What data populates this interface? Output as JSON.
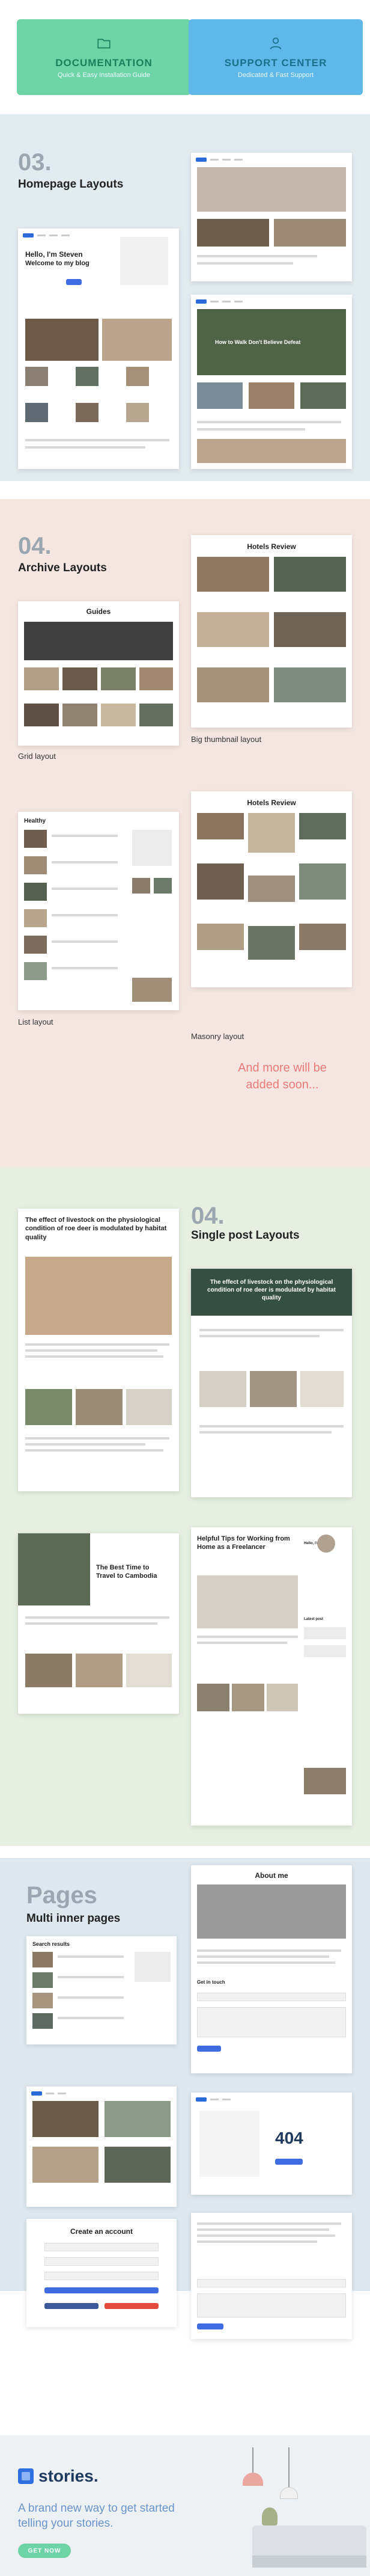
{
  "banners": {
    "documentation": {
      "title": "DOCUMENTATION",
      "subtitle": "Quick & Easy Installation Guide",
      "icon": "folder-icon"
    },
    "support": {
      "title": "SUPPORT CENTER",
      "subtitle": "Dedicated & Fast Support",
      "icon": "user-icon"
    }
  },
  "homepage": {
    "number": "03.",
    "title": "Homepage Layouts",
    "hero_greeting": "Hello, I'm Steven",
    "hero_sub": "Welcome to my blog",
    "featured_title": "How to Walk Don't Believe Defeat"
  },
  "archive": {
    "number": "04.",
    "title": "Archive Layouts",
    "grid_page_title": "Guides",
    "grid_caption": "Grid layout",
    "big_page_title": "Hotels Review",
    "big_caption": "Big thumbnail layout",
    "list_page_title": "Healthy",
    "list_caption": "List layout",
    "masonry_page_title": "Hotels Review",
    "masonry_caption": "Masonry layout",
    "teaser": "And more will be added soon..."
  },
  "single": {
    "number": "04.",
    "title": "Single post Layouts",
    "post1_title": "The effect of livestock on the physiological condition of roe deer is modulated by habitat quality",
    "post2_title": "The effect of livestock on the physiological condition of roe deer is modulated by habitat quality",
    "post3_title": "The Best Time to Travel to Cambodia",
    "post4_title": "Helpful Tips for Working from Home as a Freelancer",
    "sidebar_heading": "Latest post",
    "about_heading": "Hello, I'm Steven"
  },
  "pages": {
    "title": "Pages",
    "subtitle": "Multi inner pages",
    "search_title": "Search results",
    "about_title": "About me",
    "contact_title": "Get in touch",
    "error_code": "404",
    "account_title": "Create an account"
  },
  "footer": {
    "brand": "stories.",
    "tagline": "A brand new way to get started telling your stories.",
    "cta": "GET NOW"
  },
  "colors": {
    "doc_banner": "#6fd3a8",
    "support_banner": "#5fb8e8",
    "accent": "#2f6fe0",
    "teaser": "#e87a7a"
  }
}
